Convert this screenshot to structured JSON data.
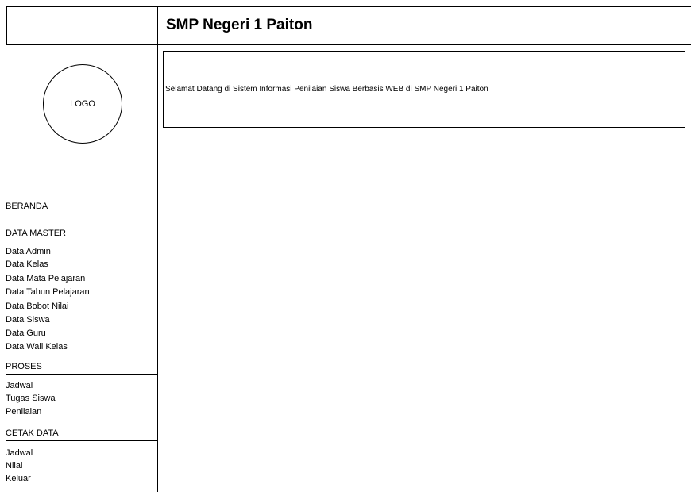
{
  "header": {
    "title": "SMP Negeri 1 Paiton"
  },
  "logo": {
    "label": "LOGO"
  },
  "welcome": {
    "text": "Selamat Datang di Sistem Informasi Penilaian Siswa Berbasis WEB di SMP Negeri 1 Paiton"
  },
  "sidebar": {
    "home_label": "BERANDA",
    "sections": [
      {
        "title": "DATA MASTER",
        "items": [
          "Data Admin",
          "Data Kelas",
          "Data Mata Pelajaran",
          "Data Tahun Pelajaran",
          "Data Bobot Nilai",
          "Data Siswa",
          "Data Guru",
          "Data Wali Kelas"
        ]
      },
      {
        "title": "PROSES",
        "items": [
          "Jadwal",
          "Tugas Siswa",
          "Penilaian"
        ]
      },
      {
        "title": "CETAK DATA",
        "items": [
          "Jadwal",
          "Nilai",
          "Keluar"
        ]
      }
    ]
  }
}
